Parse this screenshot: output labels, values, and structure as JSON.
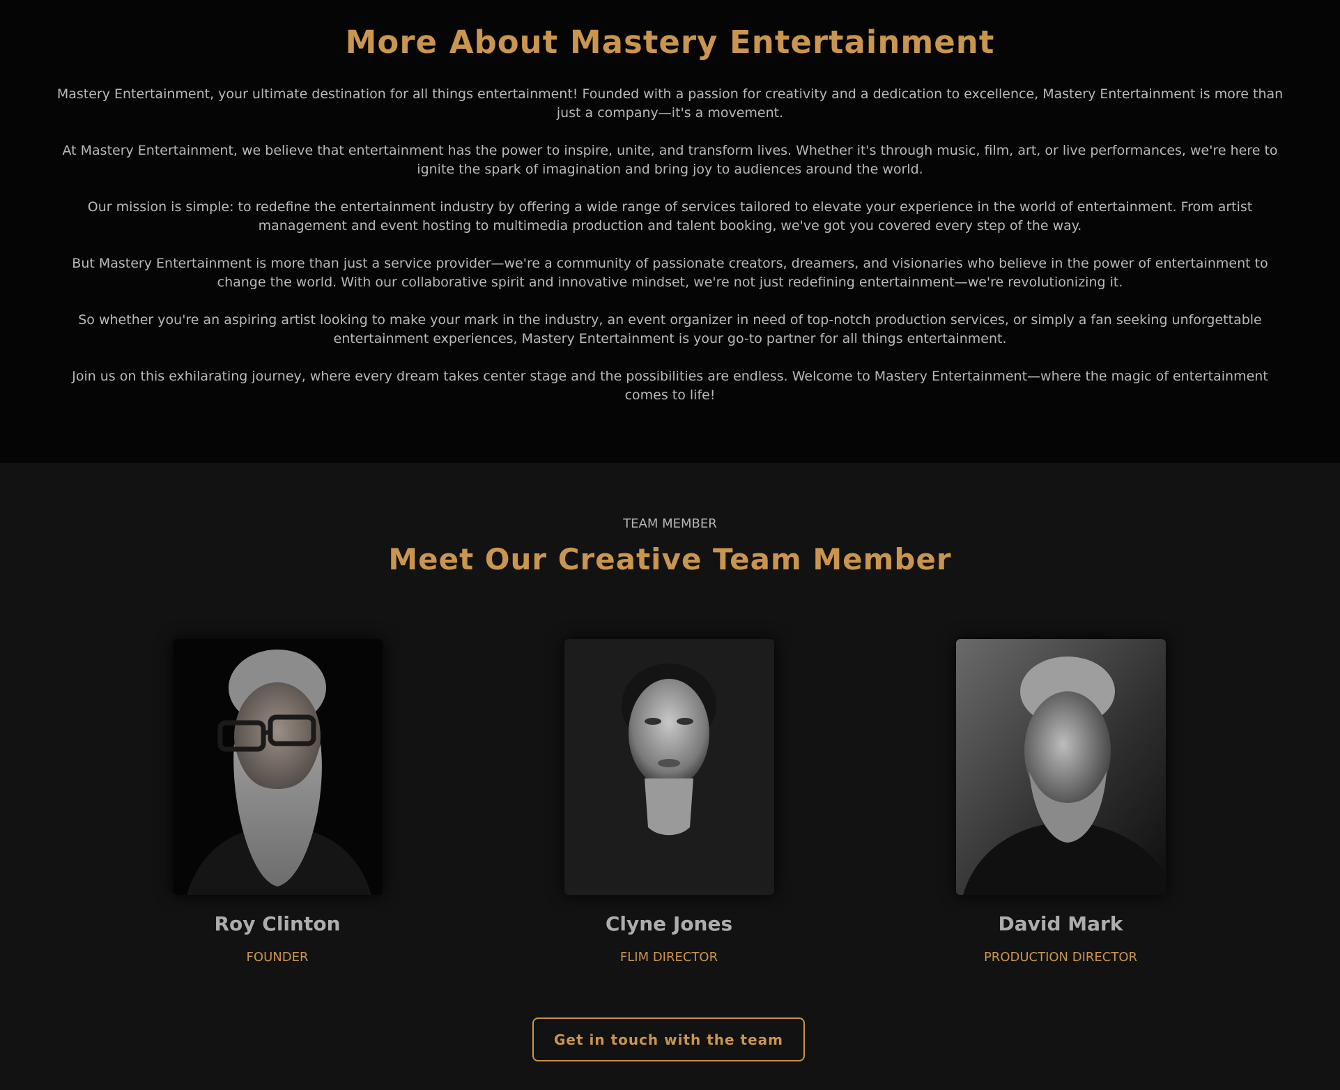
{
  "about": {
    "title": "More About Mastery Entertainment",
    "paragraphs": [
      "Mastery Entertainment, your ultimate destination for all things entertainment! Founded with a passion for creativity and a dedication to excellence, Mastery Entertainment is more than just a company—it's a movement.",
      "At Mastery Entertainment, we believe that entertainment has the power to inspire, unite, and transform lives. Whether it's through music, film, art, or live performances, we're here to ignite the spark of imagination and bring joy to audiences around the world.",
      "Our mission is simple: to redefine the entertainment industry by offering a wide range of services tailored to elevate your experience in the world of entertainment. From artist management and event hosting to multimedia production and talent booking, we've got you covered every step of the way.",
      "But Mastery Entertainment is more than just a service provider—we're a community of passionate creators, dreamers, and visionaries who believe in the power of entertainment to change the world. With our collaborative spirit and innovative mindset, we're not just redefining entertainment—we're revolutionizing it.",
      "So whether you're an aspiring artist looking to make your mark in the industry, an event organizer in need of top-notch production services, or simply a fan seeking unforgettable entertainment experiences, Mastery Entertainment is your go-to partner for all things entertainment.",
      "Join us on this exhilarating journey, where every dream takes center stage and the possibilities are endless. Welcome to Mastery Entertainment—where the magic of entertainment comes to life!"
    ]
  },
  "team": {
    "kicker": "TEAM MEMBER",
    "title": "Meet Our Creative Team Member",
    "members": [
      {
        "name": "Roy Clinton",
        "role": "FOUNDER"
      },
      {
        "name": "Clyne Jones",
        "role": "FLIM DIRECTOR"
      },
      {
        "name": "David Mark",
        "role": "PRODUCTION DIRECTOR"
      }
    ],
    "cta_label": "Get in touch with the team"
  },
  "colors": {
    "accent": "#c9954f",
    "about_background": "#050505",
    "team_background": "#121212",
    "body_text": "#b9b9b9"
  }
}
